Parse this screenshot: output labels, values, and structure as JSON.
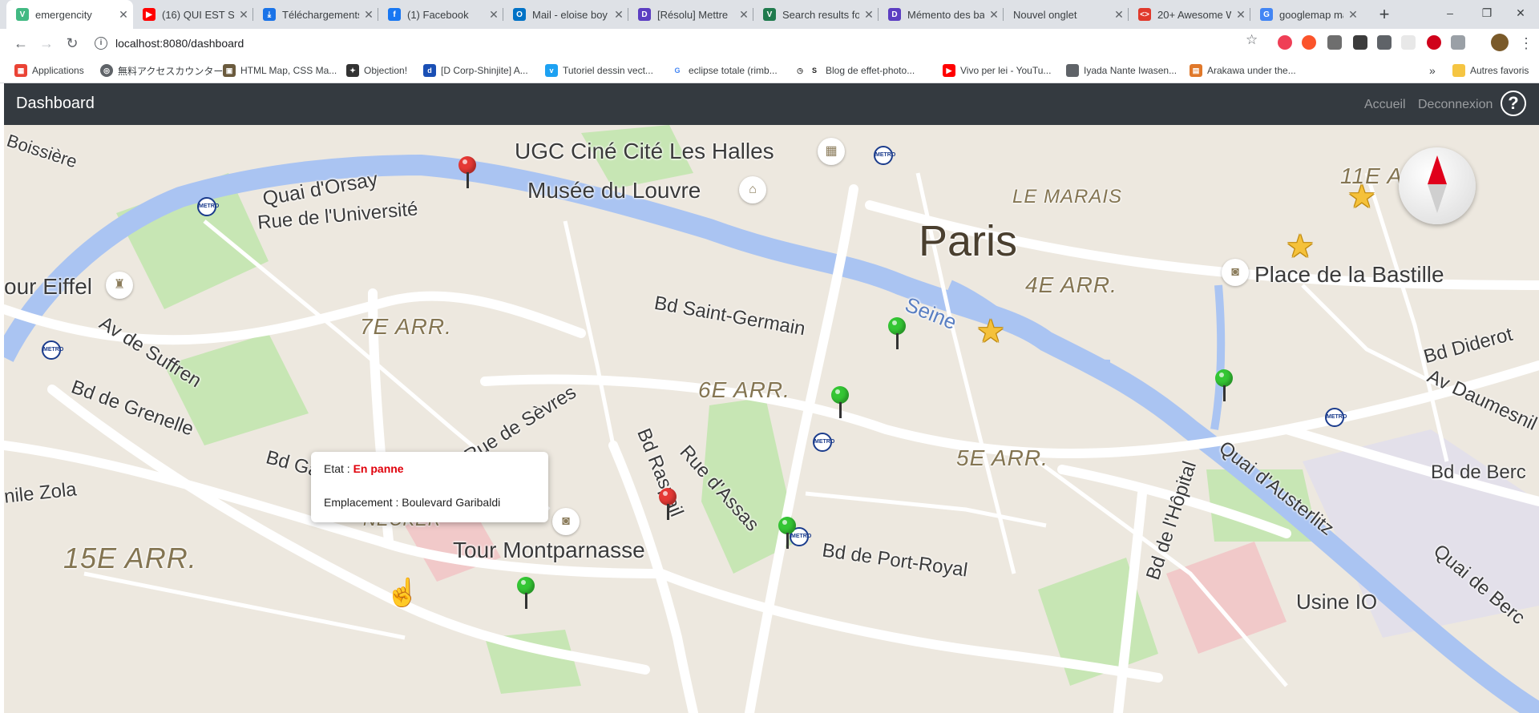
{
  "browser": {
    "tabs": [
      {
        "title": "emergencity",
        "favicon_color": "#42b983",
        "favicon_glyph": "V",
        "active": true
      },
      {
        "title": "(16) QUI EST SA",
        "favicon_color": "#ff0000",
        "favicon_glyph": "▶"
      },
      {
        "title": "Téléchargements",
        "favicon_color": "#1a73e8",
        "favicon_glyph": "⤓"
      },
      {
        "title": "(1) Facebook",
        "favicon_color": "#1877f2",
        "favicon_glyph": "f"
      },
      {
        "title": "Mail - eloise boy",
        "favicon_color": "#0072c6",
        "favicon_glyph": "O"
      },
      {
        "title": "[Résolu] Mettre",
        "favicon_color": "#5c3ec2",
        "favicon_glyph": "D"
      },
      {
        "title": "Search results fo",
        "favicon_color": "#1f7a4d",
        "favicon_glyph": "V"
      },
      {
        "title": "Mémento des ba",
        "favicon_color": "#5c3ec2",
        "favicon_glyph": "D"
      },
      {
        "title": "Nouvel onglet",
        "favicon_color": "",
        "favicon_glyph": ""
      },
      {
        "title": "20+ Awesome W",
        "favicon_color": "#e0392b",
        "favicon_glyph": "<>"
      },
      {
        "title": "googlemap mar",
        "favicon_color": "#4285f4",
        "favicon_glyph": "G"
      }
    ],
    "window_controls": {
      "minimize": "–",
      "restore": "❐",
      "close": "✕"
    },
    "url": "localhost:8080/dashboard",
    "bookmarks": [
      {
        "label": "Applications",
        "icon": "apps-grid-icon",
        "color": "#ea4335"
      },
      {
        "label": "無料アクセスカウンター...",
        "icon": "globe-icon",
        "color": "#5f6368"
      },
      {
        "label": "HTML Map, CSS Ma...",
        "icon": "map-site-icon",
        "color": "#6b5b3e"
      },
      {
        "label": "Objection!",
        "icon": "objection-icon",
        "color": "#333333"
      },
      {
        "label": "[D Corp-Shinjite] A...",
        "icon": "d-icon",
        "color": "#1a4fb5"
      },
      {
        "label": "Tutoriel dessin vect...",
        "icon": "v-icon",
        "color": "#1da1f2"
      },
      {
        "label": "eclipse totale (rimb...",
        "icon": "google-icon",
        "color": "#4285f4"
      },
      {
        "label": "Blog de effet-photo...",
        "icon": "history-sk-icon",
        "color": "#444444"
      },
      {
        "label": "Vivo per lei - YouTu...",
        "icon": "youtube-icon",
        "color": "#ff0000"
      },
      {
        "label": "Iyada Nante Iwasen...",
        "icon": "page-icon",
        "color": "#5f6368"
      },
      {
        "label": "Arakawa under the...",
        "icon": "book-icon",
        "color": "#e0782a"
      }
    ],
    "more_bookmarks": "»",
    "other_favorites": "Autres favoris"
  },
  "app": {
    "brand": "Dashboard",
    "nav": {
      "home": "Accueil",
      "logout": "Deconnexion",
      "help": "?"
    }
  },
  "map": {
    "labels": {
      "ugc": "UGC Ciné Cité Les Halles",
      "louvre": "Musée du Louvre",
      "quai_orsay": "Quai d'Orsay",
      "rue_universite": "Rue de l'Université",
      "eiffel": "our Eiffel",
      "av_suffren": "Av de Suffren",
      "bd_grenelle": "Bd de Grenelle",
      "bd_garibaldi": "Bd Garibaldi",
      "zola": "nile Zola",
      "rue_sevres": "Rue de Sèvres",
      "bd_raspail": "Bd Raspail",
      "rue_assas": "Rue d'Assas",
      "necker": "NECKER",
      "montparnasse": "Tour Montparnasse",
      "port_royal": "Bd de Port-Royal",
      "bd_st_germain": "Bd Saint-Germain",
      "seine": "Seine",
      "paris": "Paris",
      "marais": "LE MARAIS",
      "bastille": "Place de la Bastille",
      "diderot": "Bd Diderot",
      "daumesnil": "Av Daumesnil",
      "quai_austerlitz": "Quai d'Austerlitz",
      "bd_hopital": "Bd de l'Hôpital",
      "quai_bercy": "Quai de Berc",
      "bd_bercy": "Bd de Berc",
      "usine": "Usine IO",
      "arr_7": "7E ARR.",
      "arr_6": "6E ARR.",
      "arr_5": "5E ARR.",
      "arr_4": "4E ARR.",
      "arr_11": "11E ARR.",
      "arr_15": "15E ARR.",
      "boissiere": "Boissière"
    },
    "metro_label": "METRO",
    "popup": {
      "etat_label": "Etat : ",
      "etat_value": "En panne",
      "emplacement_label": "Emplacement : ",
      "emplacement_value": "Boulevard Garibaldi"
    },
    "colors": {
      "water": "#aac4f2",
      "park": "#c7e6b4",
      "road": "#ffffff",
      "land": "#ede8df",
      "pin_red": "#e53935",
      "pin_green": "#34c634",
      "star": "#f5c13a"
    }
  }
}
